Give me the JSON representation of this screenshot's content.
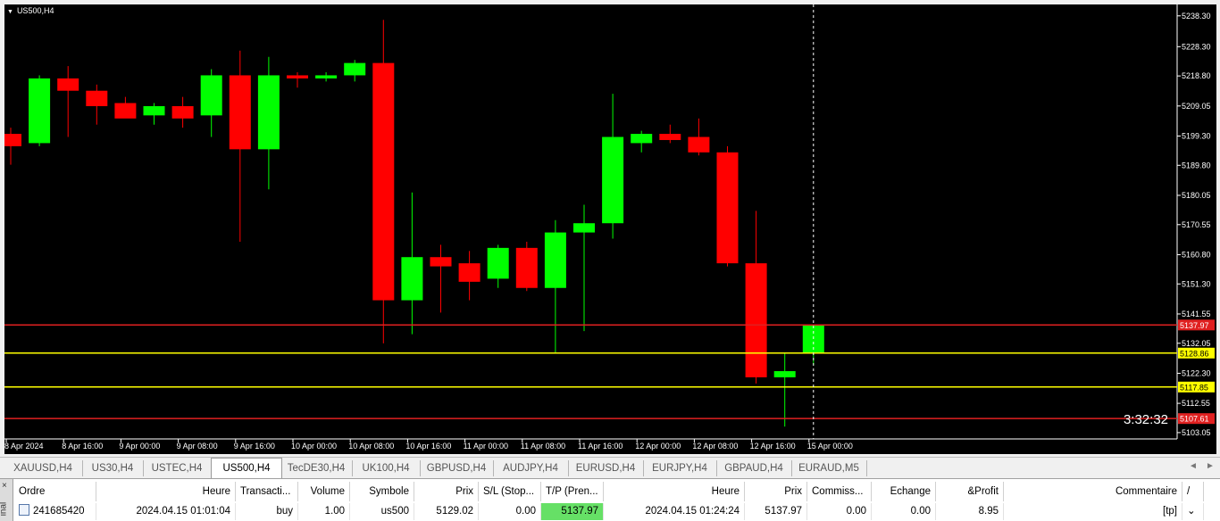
{
  "chart": {
    "symbol": "US500,H4",
    "countdown": "3:32:32",
    "colors": {
      "background": "#000000",
      "bull": "#00ff00",
      "bear": "#ff0000",
      "line_red": "#e02020",
      "line_yellow": "#ffff00"
    }
  },
  "chart_data": {
    "type": "candlestick",
    "x_labels": [
      "8 Apr 2024",
      "8 Apr 16:00",
      "9 Apr 00:00",
      "9 Apr 08:00",
      "9 Apr 16:00",
      "10 Apr 00:00",
      "10 Apr 08:00",
      "10 Apr 16:00",
      "11 Apr 00:00",
      "11 Apr 08:00",
      "11 Apr 16:00",
      "12 Apr 00:00",
      "12 Apr 08:00",
      "12 Apr 16:00",
      "15 Apr 00:00"
    ],
    "y_ticks": [
      "5238.30",
      "5228.30",
      "5218.80",
      "5209.05",
      "5199.30",
      "5189.80",
      "5180.05",
      "5170.55",
      "5160.80",
      "5151.30",
      "5141.55",
      "5132.05",
      "5122.30",
      "5112.55",
      "5103.05"
    ],
    "ylim": [
      5101,
      5242
    ],
    "candles": [
      {
        "o": 5200.0,
        "h": 5202.0,
        "l": 5190.0,
        "c": 5196.0
      },
      {
        "o": 5197.0,
        "h": 5219.0,
        "l": 5196.0,
        "c": 5218.0
      },
      {
        "o": 5218.0,
        "h": 5222.0,
        "l": 5199.0,
        "c": 5214.0
      },
      {
        "o": 5214.0,
        "h": 5216.0,
        "l": 5203.0,
        "c": 5209.0
      },
      {
        "o": 5210.0,
        "h": 5212.0,
        "l": 5206.0,
        "c": 5205.0
      },
      {
        "o": 5206.0,
        "h": 5210.0,
        "l": 5203.0,
        "c": 5209.0
      },
      {
        "o": 5209.0,
        "h": 5212.0,
        "l": 5202.0,
        "c": 5205.0
      },
      {
        "o": 5206.0,
        "h": 5221.0,
        "l": 5199.0,
        "c": 5219.0
      },
      {
        "o": 5219.0,
        "h": 5227.0,
        "l": 5165.0,
        "c": 5195.0
      },
      {
        "o": 5195.0,
        "h": 5225.0,
        "l": 5182.0,
        "c": 5219.0
      },
      {
        "o": 5219.0,
        "h": 5220.0,
        "l": 5215.0,
        "c": 5218.0
      },
      {
        "o": 5218.0,
        "h": 5220.0,
        "l": 5217.0,
        "c": 5219.0
      },
      {
        "o": 5219.0,
        "h": 5224.0,
        "l": 5217.0,
        "c": 5223.0
      },
      {
        "o": 5223.0,
        "h": 5237.0,
        "l": 5132.0,
        "c": 5146.0
      },
      {
        "o": 5146.0,
        "h": 5181.0,
        "l": 5135.0,
        "c": 5160.0
      },
      {
        "o": 5160.0,
        "h": 5164.0,
        "l": 5142.0,
        "c": 5157.0
      },
      {
        "o": 5158.0,
        "h": 5162.0,
        "l": 5146.0,
        "c": 5152.0
      },
      {
        "o": 5153.0,
        "h": 5164.0,
        "l": 5150.0,
        "c": 5163.0
      },
      {
        "o": 5163.0,
        "h": 5165.0,
        "l": 5149.0,
        "c": 5150.0
      },
      {
        "o": 5150.0,
        "h": 5172.0,
        "l": 5129.0,
        "c": 5168.0
      },
      {
        "o": 5168.0,
        "h": 5177.0,
        "l": 5136.0,
        "c": 5171.0
      },
      {
        "o": 5171.0,
        "h": 5213.0,
        "l": 5166.0,
        "c": 5199.0
      },
      {
        "o": 5197.0,
        "h": 5201.0,
        "l": 5194.0,
        "c": 5200.0
      },
      {
        "o": 5200.0,
        "h": 5203.0,
        "l": 5197.0,
        "c": 5198.0
      },
      {
        "o": 5199.0,
        "h": 5205.0,
        "l": 5193.0,
        "c": 5194.0
      },
      {
        "o": 5194.0,
        "h": 5196.0,
        "l": 5157.0,
        "c": 5158.0
      },
      {
        "o": 5158.0,
        "h": 5175.0,
        "l": 5119.0,
        "c": 5121.0
      },
      {
        "o": 5121.0,
        "h": 5129.0,
        "l": 5105.0,
        "c": 5123.0
      },
      {
        "o": 5129.0,
        "h": 5137.97,
        "l": 5125.0,
        "c": 5137.97
      }
    ],
    "price_lines": [
      {
        "label": "5137.97",
        "value": 5137.97,
        "color": "red"
      },
      {
        "label": "5128.86",
        "value": 5128.86,
        "color": "yellow"
      },
      {
        "label": "5117.85",
        "value": 5117.85,
        "color": "yellow"
      },
      {
        "label": "5107.61",
        "value": 5107.61,
        "color": "red"
      }
    ]
  },
  "tabs": {
    "items": [
      "XAUUSD,H4",
      "US30,H4",
      "USTEC,H4",
      "US500,H4",
      "TecDE30,H4",
      "UK100,H4",
      "GBPUSD,H4",
      "AUDJPY,H4",
      "EURUSD,H4",
      "EURJPY,H4",
      "GBPAUD,H4",
      "EURAUD,M5"
    ],
    "active": "US500,H4",
    "nav_left": "◄",
    "nav_right": "►"
  },
  "terminal": {
    "side_label": "inal",
    "close_label": "×",
    "headers": [
      "Ordre",
      "Heure",
      "Transacti...",
      "Volume",
      "Symbole",
      "Prix",
      "S/L (Stop...",
      "T/P (Pren...",
      "Heure",
      "Prix",
      "Commiss...",
      "Echange",
      "&Profit",
      "Commentaire",
      "/"
    ],
    "row": [
      "241685420",
      "2024.04.15 01:01:04",
      "buy",
      "1.00",
      "us500",
      "5129.02",
      "0.00",
      "5137.97",
      "2024.04.15 01:24:24",
      "5137.97",
      "0.00",
      "0.00",
      "8.95",
      "[tp]",
      "⌄"
    ]
  }
}
